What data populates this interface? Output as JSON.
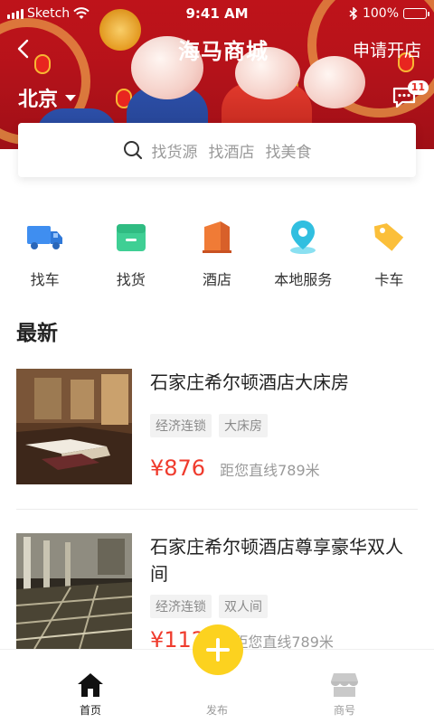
{
  "status_bar": {
    "carrier": "Sketch",
    "time": "9:41 AM",
    "battery": "100%"
  },
  "nav": {
    "title": "海马商城",
    "action": "申请开店"
  },
  "city": {
    "name": "北京"
  },
  "messages": {
    "badge_count": "11"
  },
  "search": {
    "hints": [
      "找货源",
      "找酒店",
      "找美食"
    ]
  },
  "categories": [
    {
      "label": "找车",
      "icon": "truck-icon",
      "color": "#3f8ef0"
    },
    {
      "label": "找货",
      "icon": "box-icon",
      "color": "#3fcf94"
    },
    {
      "label": "酒店",
      "icon": "hotel-icon",
      "color": "#f07b36"
    },
    {
      "label": "本地服务",
      "icon": "location-pin-icon",
      "color": "#31bfe0"
    },
    {
      "label": "卡车",
      "icon": "price-tag-icon",
      "color": "#fbbf3a"
    }
  ],
  "section": {
    "title": "最新"
  },
  "listings": [
    {
      "title": "石家庄希尔顿酒店大床房",
      "tags": [
        "经济连锁",
        "大床房"
      ],
      "price": "¥876",
      "distance": "距您直线789米"
    },
    {
      "title": "石家庄希尔顿酒店尊享豪华双人间",
      "tags": [
        "经济连锁",
        "双人间"
      ],
      "price": "¥1124",
      "distance": "距您直线789米"
    }
  ],
  "tabs": {
    "home": "首页",
    "publish": "发布",
    "shop": "商号"
  },
  "colors": {
    "brand_red": "#c8141b",
    "price_red": "#ef3b2d",
    "publish_yellow": "#fcd21f"
  }
}
